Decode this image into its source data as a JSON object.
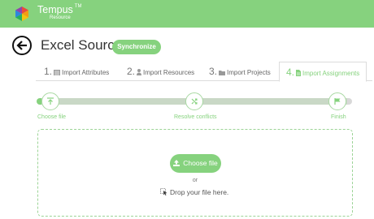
{
  "app": {
    "name": "Tempus",
    "trademark": "TM",
    "subtitle": "Resource"
  },
  "header": {
    "title": "Excel Source",
    "sync_label": "Synchronize"
  },
  "tabs": [
    {
      "num": "1.",
      "label": "Import Attributes",
      "icon": "list-icon",
      "active": false
    },
    {
      "num": "2.",
      "label": "Import Resources",
      "icon": "person-icon",
      "active": false
    },
    {
      "num": "3.",
      "label": "Import Projects",
      "icon": "folder-icon",
      "active": false
    },
    {
      "num": "4.",
      "label": "Import Assignments",
      "icon": "document-icon",
      "active": true
    }
  ],
  "steps": [
    {
      "label": "Choose file",
      "icon": "upload-icon"
    },
    {
      "label": "Resolve conflicts",
      "icon": "shuffle-icon"
    },
    {
      "label": "Finish",
      "icon": "flag-icon"
    }
  ],
  "upload": {
    "button_label": "Choose file",
    "or_text": "or",
    "drop_text": "Drop your file here."
  },
  "colors": {
    "accent": "#86d27e",
    "track": "#c9d8c6"
  }
}
